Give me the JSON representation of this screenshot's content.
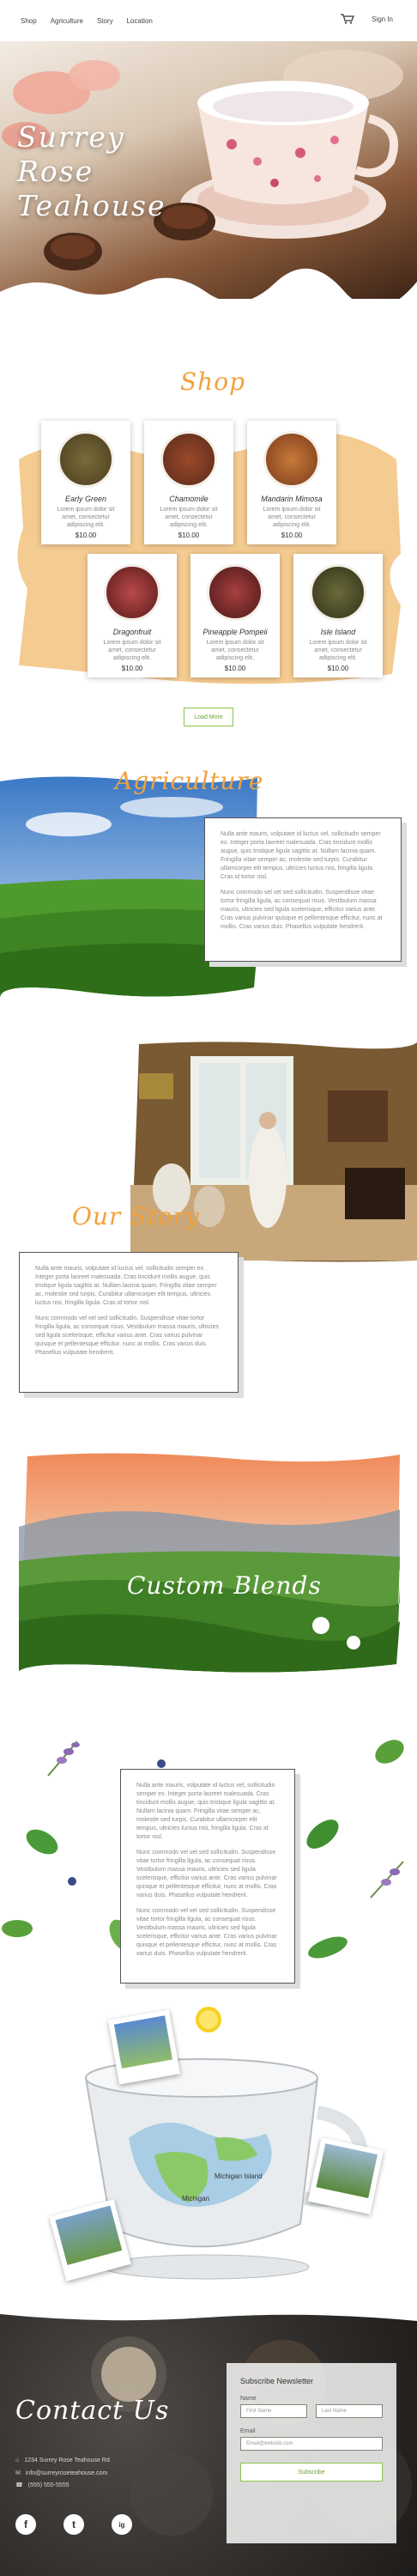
{
  "nav": {
    "links": [
      "Shop",
      "Agriculture",
      "Story",
      "Location"
    ],
    "signin": "Sign In"
  },
  "hero": {
    "title": "Surrey Rose Teahouse"
  },
  "shop": {
    "title": "Shop",
    "products": [
      {
        "name": "Early Green",
        "desc": "Lorem ipsum dolor sit amet, consectetur adipiscing elit.",
        "price": "$10.00",
        "color": "#6b5b2a"
      },
      {
        "name": "Chamomile",
        "desc": "Lorem ipsum dolor sit amet, consectetur adipiscing elit.",
        "price": "$10.00",
        "color": "#7a3b2a"
      },
      {
        "name": "Mandarin Mimosa",
        "desc": "Lorem ipsum dolor sit amet, consectetur adipiscing elit.",
        "price": "$10.00",
        "color": "#9a5a2a"
      },
      {
        "name": "Dragonfruit",
        "desc": "Lorem ipsum dolor sit amet, consectetur adipiscing elit.",
        "price": "$10.00",
        "color": "#7a2a2a"
      },
      {
        "name": "Pineapple Pompeii",
        "desc": "Lorem ipsum dolor sit amet, consectetur adipiscing elit.",
        "price": "$10.00",
        "color": "#6a2a2a"
      },
      {
        "name": "Isle Island",
        "desc": "Lorem ipsum dolor sit amet, consectetur adipiscing elit.",
        "price": "$10.00",
        "color": "#4a4a2a"
      }
    ],
    "load_more": "Load More"
  },
  "agriculture": {
    "title": "Agriculture",
    "paragraphs": [
      "Nulla ante mauris, volputate id luctus vel, sollicitudin semper ex. Integer porta laoreet malesuada. Cras tincidunt mollis augue, quis tristique ligula sagittis at. Nullam lacinia quam. Fringilla vitae semper ac, molestie sed turpis. Curabitur ullamcorper elit tempus, ultricies luctus nisi, fringilla ligula. Cras id tortor nisl.",
      "Nunc commodo vel vel sed sollicitudin. Suspendisse vitae tortor fringilla ligula, ac consequat risus. Vestibulum massa mauris, ultricies sed ligula scelerisque, efficitur varius ante. Cras varius pulvinar quisque et pellentesque efficitur, nunc at mollis. Cras varius duis. Phasellus vulputate hendrerit."
    ]
  },
  "story": {
    "title": "Our Story",
    "paragraphs": [
      "Nulla ante mauris, volputate id luctus vel, sollicitudin semper ex. Integer porta laoreet malesuada. Cras tincidunt mollis augue, quis tristique ligula sagittis at. Nullam lacinia quam. Fringilla vitae semper ac, molestie sed turpis. Curabitur ullamcorper elit tempus, ultricies luctus nisi, fringilla ligula. Cras id tortor nisl.",
      "Nunc commodo vel vel sed sollicitudin. Suspendisse vitae tortor fringilla ligula, ac consequat risus. Vestibulum massa mauris, ultricies sed ligula scelerisque, efficitur varius ante. Cras varius pulvinar quisque et pellentesque efficitur, nunc at mollis. Cras varius duis. Phasellus vulputate hendrerit."
    ]
  },
  "blends": {
    "title": "Custom Blends",
    "paragraphs": [
      "Nulla ante mauris, volputate id luctus vel, sollicitudin semper ex. Integer porta laoreet malesuada. Cras tincidunt mollis augue, quis tristique ligula sagittis at. Nullam lacinia quam. Fringilla vitae semper ac, molestie sed turpis. Curabitur ullamcorper elit tempus, ultricies luctus nisi, fringilla ligula. Cras id tortor nisl.",
      "Nunc commodo vel vel sed sollicitudin. Suspendisse vitae tortor fringilla ligula, ac consequat risus. Vestibulum massa mauris, ultricies sed ligula scelerisque, efficitur varius ante. Cras varius pulvinar quisque et pellentesque efficitur, nunc at mollis. Cras varius duis. Phasellus vulputate hendrerit.",
      "Nunc commodo vel vel sed sollicitudin. Suspendisse vitae tortor fringilla ligula, ac consequat risus. Vestibulum massa mauris, ultricies sed ligula scelerisque, efficitur varius ante. Cras varius pulvinar quisque et pellentesque efficitur, nunc at mollis. Cras varius duis. Phasellus vulputate hendrerit."
    ]
  },
  "map": {
    "labels": [
      "Michigan Island",
      "Michigan"
    ]
  },
  "contact": {
    "title": "Contact Us",
    "lines": [
      "1234 Surrey Rose Teahouse Rd",
      "info@surreyroseteahouse.com",
      "(555) 555-5555"
    ],
    "social": [
      "f",
      "t",
      "ig"
    ],
    "newsletter": {
      "title": "Subscribe Newsletter",
      "name_label": "Name",
      "first_placeholder": "First Name",
      "last_placeholder": "Last Name",
      "email_label": "Email",
      "email_placeholder": "Email@website.com",
      "button": "Subscribe"
    }
  },
  "colors": {
    "accent": "#f2a13c",
    "green": "#8bc34a"
  }
}
